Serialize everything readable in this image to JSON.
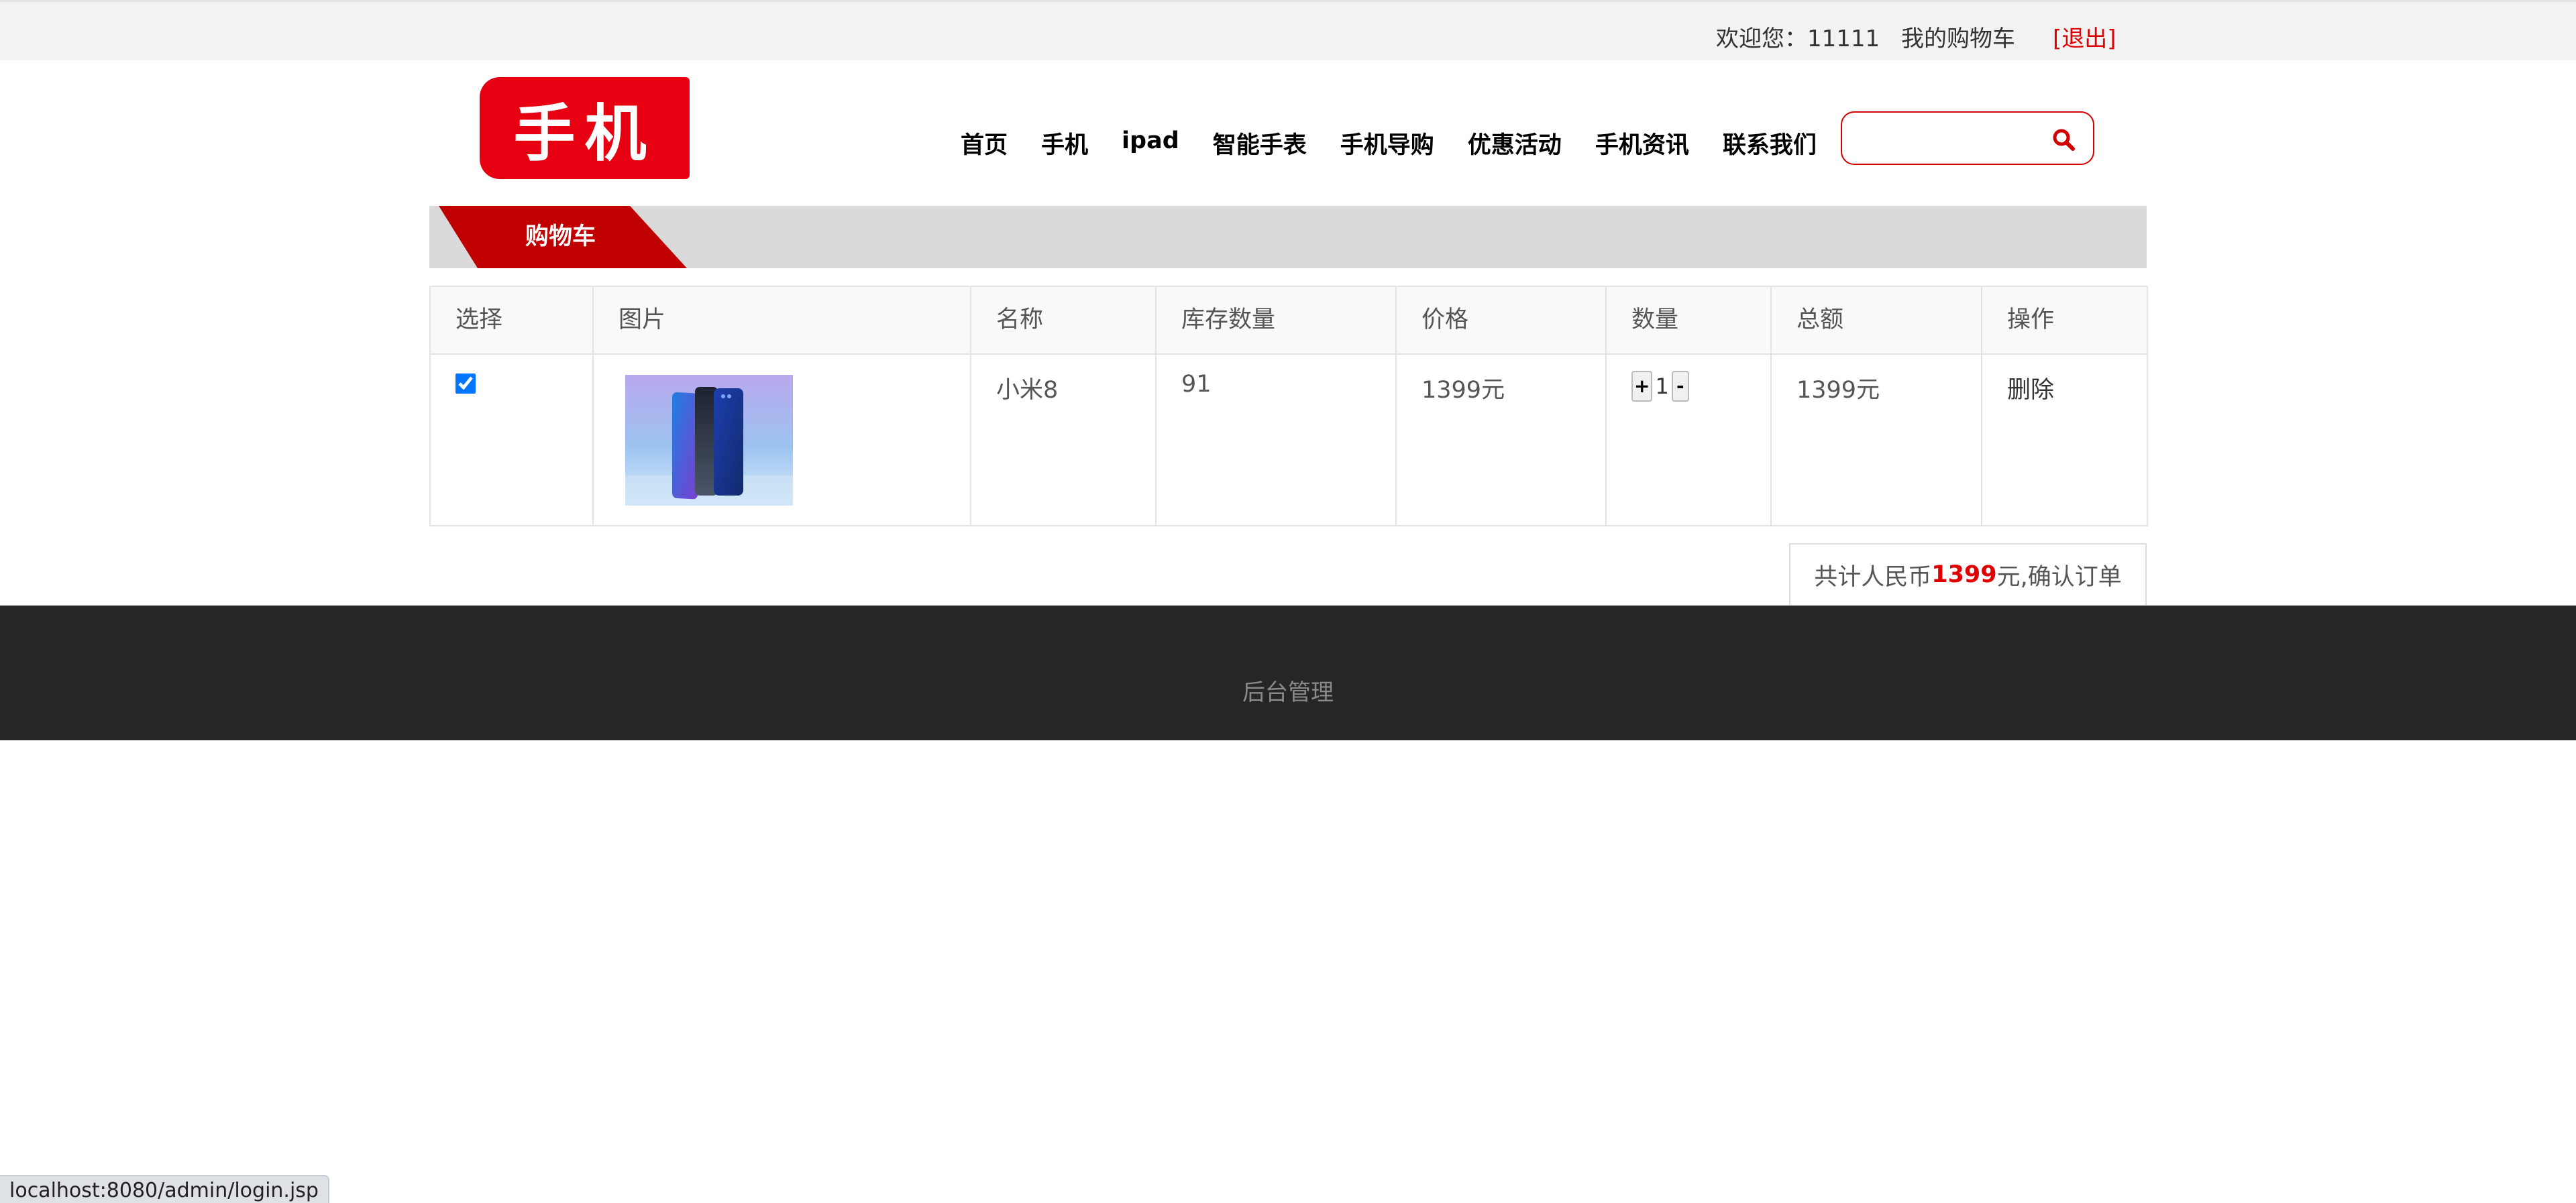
{
  "topbar": {
    "welcome_label": "欢迎您：",
    "username": "11111",
    "cart_link": "我的购物车",
    "logout_link": "[退出]"
  },
  "logo": {
    "text": "手机"
  },
  "nav": {
    "items": [
      "首页",
      "手机",
      "ipad",
      "智能手表",
      "手机导购",
      "优惠活动",
      "手机资讯",
      "联系我们"
    ]
  },
  "search": {
    "value": "",
    "placeholder": "",
    "icon": "search-icon"
  },
  "section": {
    "title": "购物车"
  },
  "cart_table": {
    "headers": [
      "选择",
      "图片",
      "名称",
      "库存数量",
      "价格",
      "数量",
      "总额",
      "操作"
    ],
    "rows": [
      {
        "checked": true,
        "name": "小米8",
        "stock": "91",
        "price": "1399元",
        "qty_plus": "+",
        "quantity": "1",
        "qty_minus": "-",
        "total": "1399元",
        "action": "删除"
      }
    ]
  },
  "summary": {
    "prefix": "共计人民币",
    "amount": "1399",
    "suffix": "元,确认订单"
  },
  "footer": {
    "admin_link": "后台管理"
  },
  "status_bar": {
    "url": "localhost:8080/admin/login.jsp"
  },
  "colors": {
    "brand_red": "#e60012",
    "tab_red": "#c00000",
    "footer_bg": "#262626",
    "accent_link": "#e00000"
  }
}
